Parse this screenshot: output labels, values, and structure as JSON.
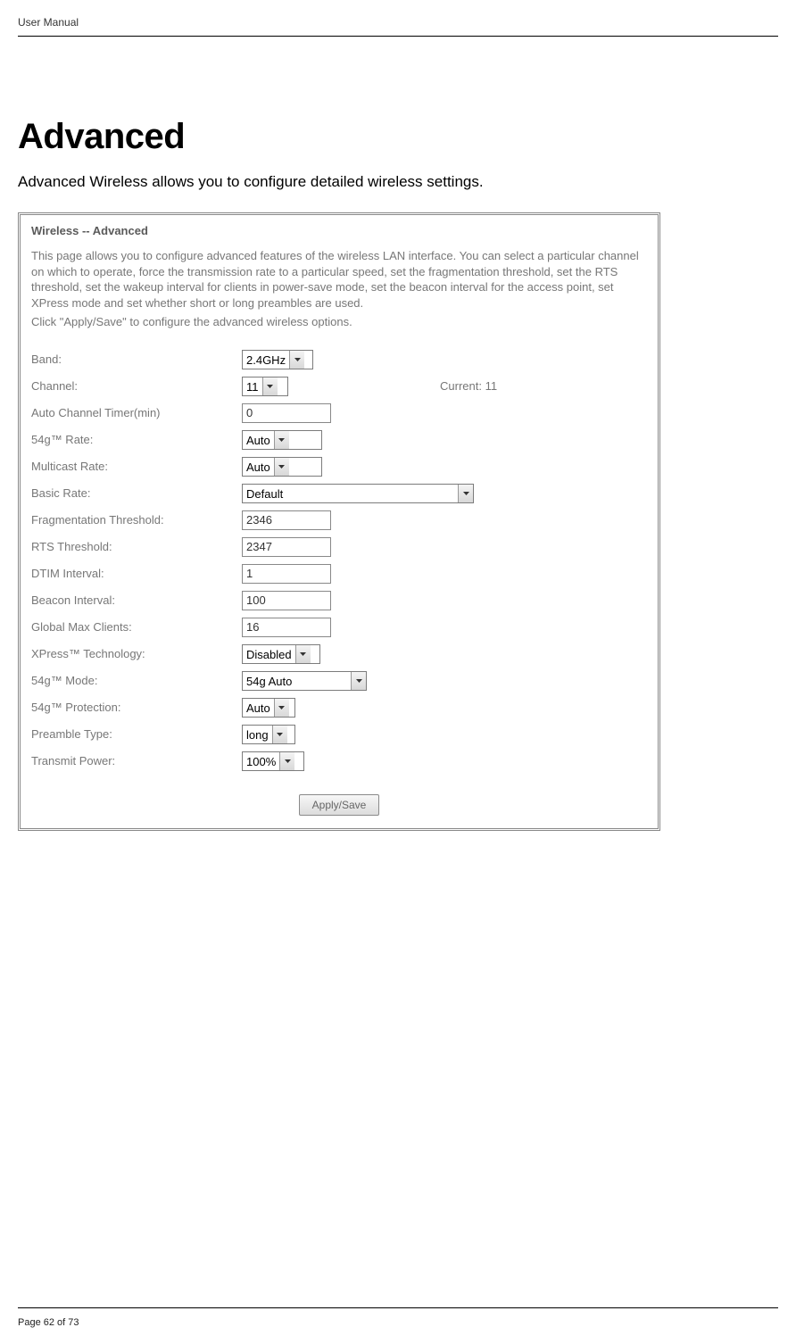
{
  "doc": {
    "header": "User Manual",
    "section_title": "Advanced",
    "section_desc": "Advanced Wireless allows you to configure detailed wireless settings.",
    "footer": "Page 62 of 73"
  },
  "panel": {
    "title": "Wireless -- Advanced",
    "paragraph": "This page allows you to configure advanced features of the wireless LAN interface. You can select a particular channel on which to operate, force the transmission rate to a particular speed, set the fragmentation threshold, set the RTS threshold, set the wakeup interval for clients in power-save mode, set the beacon interval for the access point, set XPress mode and set whether short or long preambles are used.",
    "instruction": "Click \"Apply/Save\" to configure the advanced wireless options.",
    "current_label": "Current: 11",
    "apply_label": "Apply/Save",
    "fields": {
      "band": {
        "label": "Band:",
        "value": "2.4GHz"
      },
      "channel": {
        "label": "Channel:",
        "value": "11"
      },
      "auto_channel_timer": {
        "label": "Auto Channel Timer(min)",
        "value": "0"
      },
      "rate_54g": {
        "label": "54g™ Rate:",
        "value": "Auto"
      },
      "multicast_rate": {
        "label": "Multicast Rate:",
        "value": "Auto"
      },
      "basic_rate": {
        "label": "Basic Rate:",
        "value": "Default"
      },
      "frag_threshold": {
        "label": "Fragmentation Threshold:",
        "value": "2346"
      },
      "rts_threshold": {
        "label": "RTS Threshold:",
        "value": "2347"
      },
      "dtim_interval": {
        "label": "DTIM Interval:",
        "value": "1"
      },
      "beacon_interval": {
        "label": "Beacon Interval:",
        "value": "100"
      },
      "global_max_clients": {
        "label": "Global Max Clients:",
        "value": "16"
      },
      "xpress": {
        "label": "XPress™ Technology:",
        "value": "Disabled"
      },
      "mode_54g": {
        "label": "54g™ Mode:",
        "value": "54g Auto"
      },
      "protection_54g": {
        "label": "54g™ Protection:",
        "value": "Auto"
      },
      "preamble": {
        "label": "Preamble Type:",
        "value": "long"
      },
      "tx_power": {
        "label": "Transmit Power:",
        "value": "100%"
      }
    }
  }
}
